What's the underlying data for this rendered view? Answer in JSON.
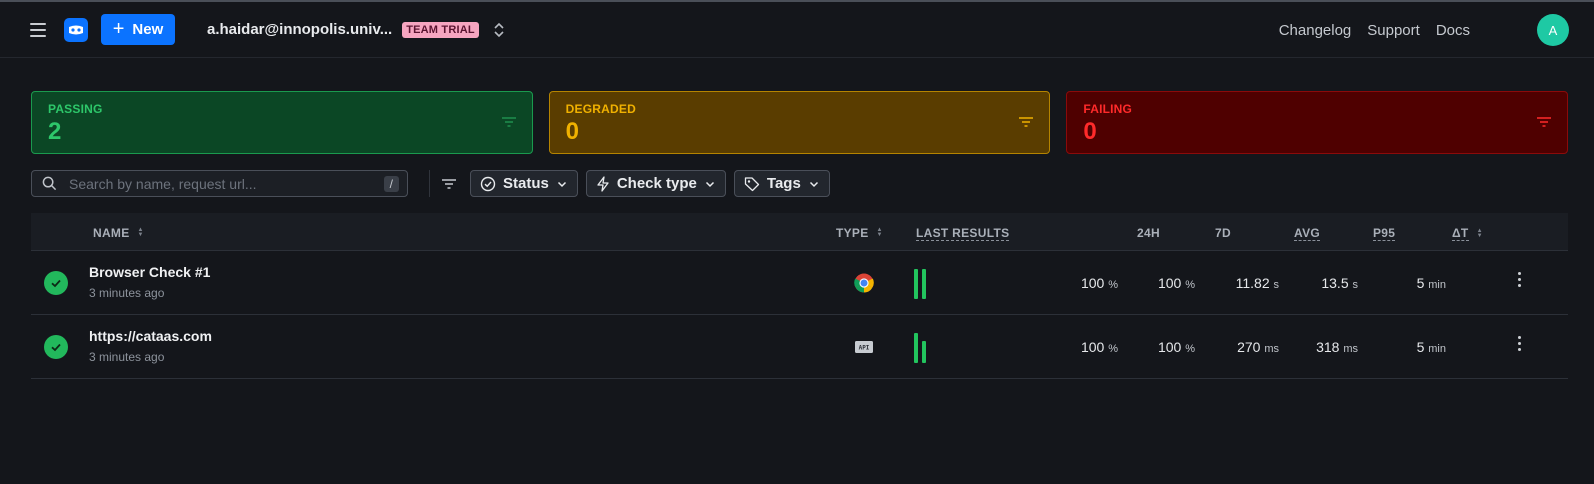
{
  "header": {
    "new_label": "New",
    "account": "a.haidar@innopolis.univ...",
    "plan_badge": "TEAM TRIAL",
    "nav": [
      "Changelog",
      "Support",
      "Docs"
    ],
    "avatar_initial": "A"
  },
  "summary": {
    "passing": {
      "label": "PASSING",
      "count": "2",
      "color": "#2dc76a"
    },
    "degraded": {
      "label": "DEGRADED",
      "count": "0",
      "color": "#f0b100"
    },
    "failing": {
      "label": "FAILING",
      "count": "0",
      "color": "#ff2a2a"
    }
  },
  "filters": {
    "search_placeholder": "Search by name, request url...",
    "search_shortcut": "/",
    "status_label": "Status",
    "check_type_label": "Check type",
    "tags_label": "Tags"
  },
  "table": {
    "columns": {
      "name": "NAME",
      "type": "TYPE",
      "last_results": "LAST RESULTS",
      "h24": "24H",
      "d7": "7D",
      "avg": "AVG",
      "p95": "P95",
      "delta_t": "ΔT"
    },
    "rows": [
      {
        "name": "Browser Check #1",
        "updated": "3 minutes ago",
        "type_icon": "chrome-icon",
        "h24": "100",
        "h24_unit": "%",
        "d7": "100",
        "d7_unit": "%",
        "avg": "11.82",
        "avg_unit": "s",
        "p95": "13.5",
        "p95_unit": "s",
        "delta_t": "5",
        "delta_t_unit": "min"
      },
      {
        "name": "https://cataas.com",
        "updated": "3 minutes ago",
        "type_icon": "api-icon",
        "type_text": "API",
        "h24": "100",
        "h24_unit": "%",
        "d7": "100",
        "d7_unit": "%",
        "avg": "270",
        "avg_unit": "ms",
        "p95": "318",
        "p95_unit": "ms",
        "delta_t": "5",
        "delta_t_unit": "min"
      }
    ]
  }
}
